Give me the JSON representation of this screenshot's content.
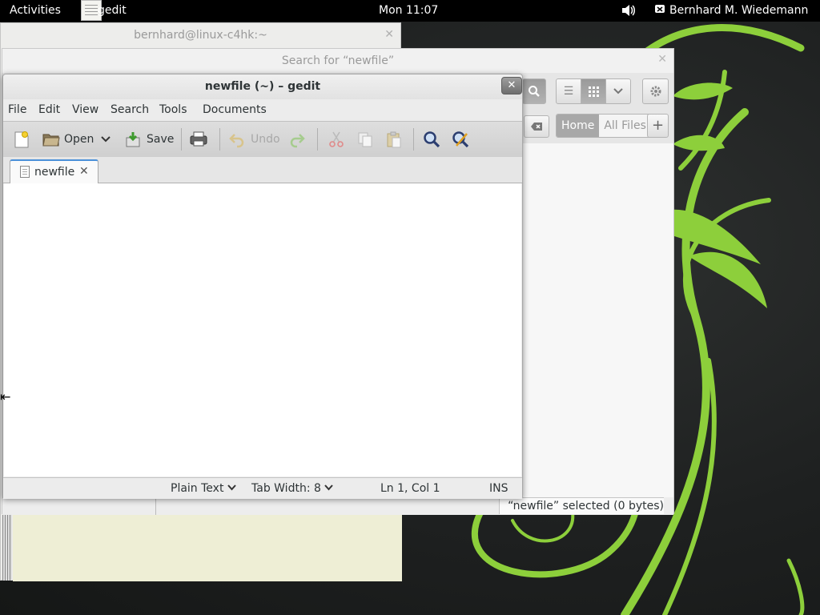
{
  "topbar": {
    "activities": "Activities",
    "app_name": "gedit",
    "clock": "Mon 11:07",
    "volume_icon": "volume-icon",
    "user_name": "Bernhard M. Wiedemann",
    "user_icon": "chat-status-icon"
  },
  "terminal": {
    "title": "bernhard@linux-c4hk:~"
  },
  "files": {
    "title": "Search for “newfile”",
    "location_buttons": [
      "Home",
      "All Files"
    ],
    "active_location": "Home",
    "status": "“newfile” selected  (0 bytes)"
  },
  "gedit": {
    "title": "newfile (~) – gedit",
    "menu": [
      "File",
      "Edit",
      "View",
      "Search",
      "Tools",
      "Documents"
    ],
    "toolbar": {
      "open": "Open",
      "save": "Save",
      "undo": "Undo"
    },
    "tab": {
      "label": "newfile",
      "close": "✕"
    },
    "status": {
      "language": "Plain Text",
      "tab_width": "Tab Width: 8",
      "position": "Ln 1, Col 1",
      "mode": "INS"
    }
  },
  "colors": {
    "accent": "#4a90d9",
    "swirl": "#8ed03a",
    "topbar": "#000000"
  }
}
